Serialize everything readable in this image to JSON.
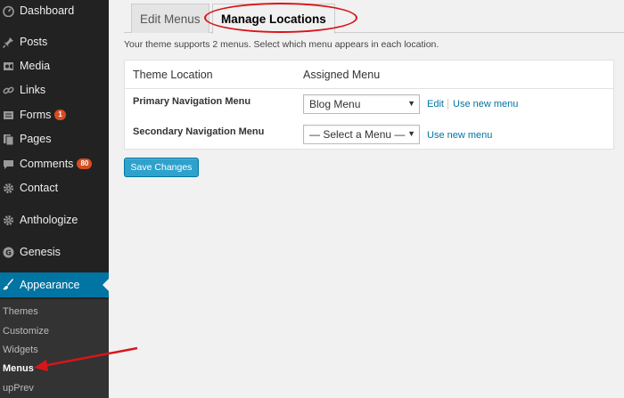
{
  "sidebar": {
    "items": [
      {
        "label": "Dashboard",
        "icon": "dashboard-icon"
      },
      {
        "label": "Posts",
        "icon": "pin-icon"
      },
      {
        "label": "Media",
        "icon": "media-icon"
      },
      {
        "label": "Links",
        "icon": "link-icon"
      },
      {
        "label": "Forms",
        "icon": "forms-icon",
        "badge": "1"
      },
      {
        "label": "Pages",
        "icon": "pages-icon"
      },
      {
        "label": "Comments",
        "icon": "comment-icon",
        "badge": "80"
      },
      {
        "label": "Contact",
        "icon": "gear-icon"
      },
      {
        "label": "Anthologize",
        "icon": "gear-icon"
      },
      {
        "label": "Genesis",
        "icon": "genesis-icon"
      },
      {
        "label": "Appearance",
        "icon": "paintbrush-icon"
      }
    ],
    "submenu": [
      "Themes",
      "Customize",
      "Widgets",
      "Menus",
      "upPrev"
    ]
  },
  "tabs": {
    "edit": "Edit Menus",
    "manage": "Manage Locations"
  },
  "intro": "Your theme supports 2 menus. Select which menu appears in each location.",
  "table": {
    "col_location": "Theme Location",
    "col_assigned": "Assigned Menu",
    "rows": [
      {
        "label": "Primary Navigation Menu",
        "selected": "Blog Menu",
        "edit": "Edit",
        "new": "Use new menu"
      },
      {
        "label": "Secondary Navigation Menu",
        "selected": "— Select a Menu —",
        "new": "Use new menu"
      }
    ]
  },
  "save_label": "Save Changes",
  "colors": {
    "sidebar_bg": "#222222",
    "active_bg": "#0074a2",
    "button": "#2ea2cc",
    "annotation": "#d9151a",
    "badge": "#d54e21"
  }
}
